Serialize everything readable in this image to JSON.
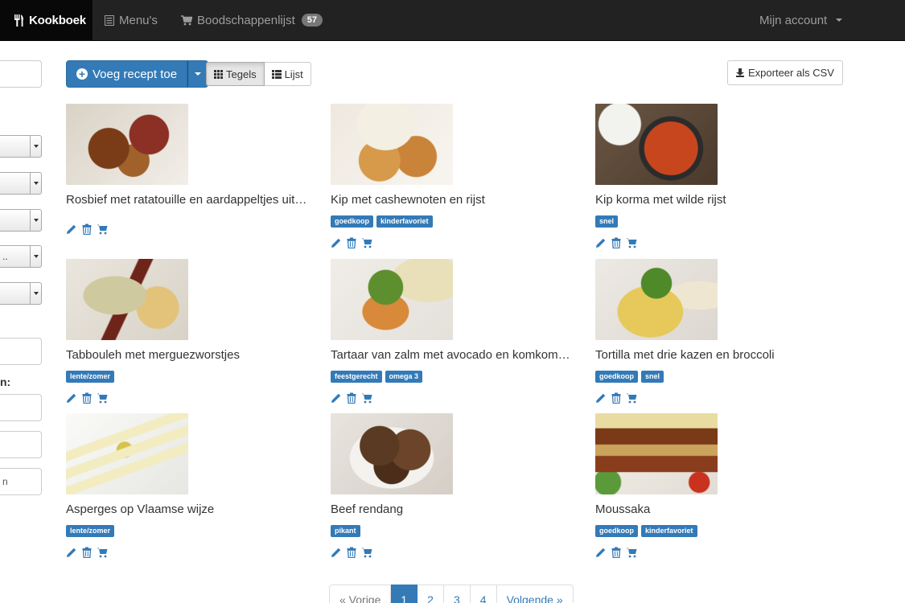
{
  "navbar": {
    "brand": "Kookboek",
    "menus": "Menu's",
    "shopping_list": "Boodschappenlijst",
    "shopping_count": "57",
    "account": "Mijn account"
  },
  "filters": {
    "select_partial_text": "..",
    "label_partial": "n:",
    "input_partial_text": "n"
  },
  "toolbar": {
    "add_recipe": "Voeg recept toe",
    "view_tiles": "Tegels",
    "view_list": "Lijst",
    "export_csv": "Exporteer als CSV"
  },
  "recipes": [
    {
      "title": "Rosbief met ratatouille en aardappeltjes uit de oven",
      "tags": []
    },
    {
      "title": "Kip met cashewnoten en rijst",
      "tags": [
        "goedkoop",
        "kinderfavoriet"
      ]
    },
    {
      "title": "Kip korma met wilde rijst",
      "tags": [
        "snel"
      ]
    },
    {
      "title": "Tabbouleh met merguezworstjes",
      "tags": [
        "lente/zomer"
      ]
    },
    {
      "title": "Tartaar van zalm met avocado en komkommer",
      "tags": [
        "feestgerecht",
        "omega 3"
      ]
    },
    {
      "title": "Tortilla met drie kazen en broccoli",
      "tags": [
        "goedkoop",
        "snel"
      ]
    },
    {
      "title": "Asperges op Vlaamse wijze",
      "tags": [
        "lente/zomer"
      ]
    },
    {
      "title": "Beef rendang",
      "tags": [
        "pikant"
      ]
    },
    {
      "title": "Moussaka",
      "tags": [
        "goedkoop",
        "kinderfavoriet"
      ]
    }
  ],
  "pagination": {
    "prev": "« Vorige",
    "pages": [
      "1",
      "2",
      "3",
      "4"
    ],
    "next": "Volgende »"
  },
  "colors": {
    "primary": "#337ab7",
    "navbar_bg": "#222222"
  }
}
